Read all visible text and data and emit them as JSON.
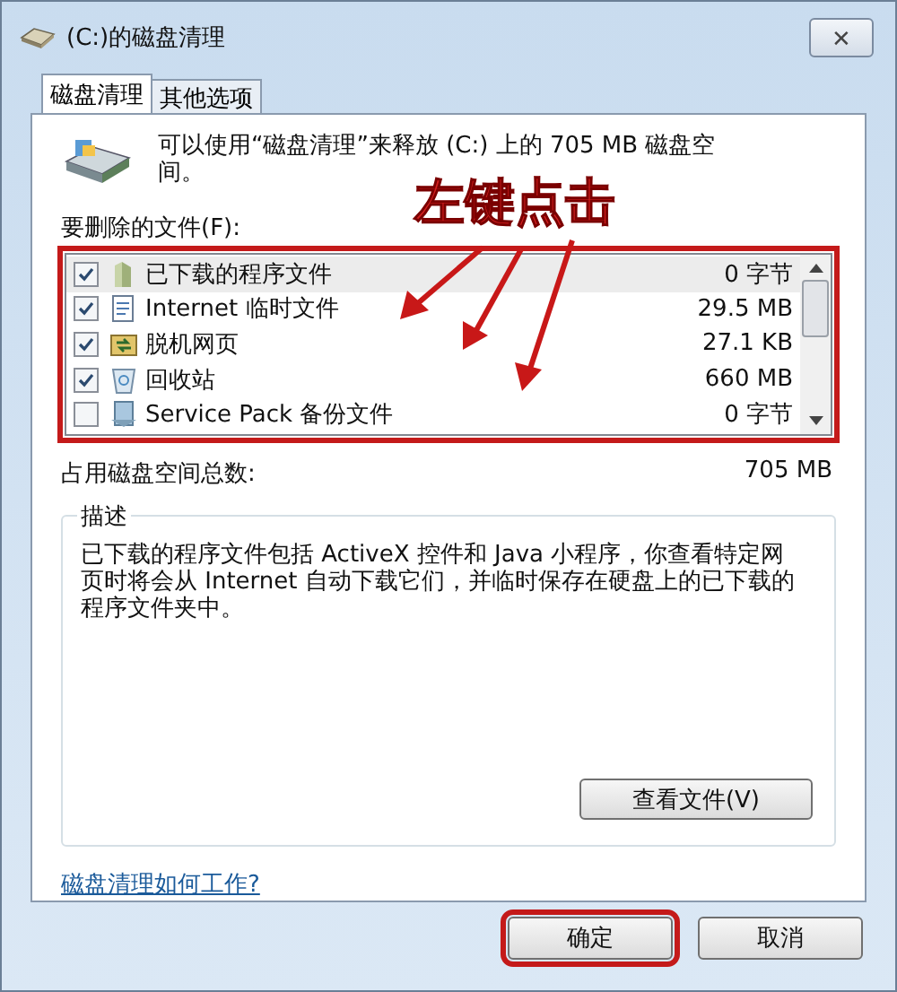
{
  "window": {
    "title": "(C:)的磁盘清理",
    "close": "✕"
  },
  "tabs": [
    {
      "label": "磁盘清理",
      "selected": true
    },
    {
      "label": "其他选项",
      "selected": false
    }
  ],
  "header_text": "可以使用“磁盘清理”来释放 (C:) 上的 705 MB 磁盘空间。",
  "files_label": "要删除的文件(F):",
  "files": [
    {
      "name": "已下载的程序文件",
      "size": "0 字节",
      "checked": true,
      "selected": true
    },
    {
      "name": "Internet 临时文件",
      "size": "29.5 MB",
      "checked": true,
      "selected": false
    },
    {
      "name": "脱机网页",
      "size": "27.1 KB",
      "checked": true,
      "selected": false
    },
    {
      "name": "回收站",
      "size": "660 MB",
      "checked": true,
      "selected": false
    },
    {
      "name": "Service Pack 备份文件",
      "size": "0 字节",
      "checked": false,
      "selected": false
    }
  ],
  "total": {
    "label": "占用磁盘空间总数:",
    "value": "705 MB"
  },
  "description": {
    "title": "描述",
    "text": "已下载的程序文件包括 ActiveX 控件和 Java 小程序，你查看特定网页时将会从 Internet 自动下载它们，并临时保存在硬盘上的已下载的程序文件夹中。",
    "button": "查看文件(V)"
  },
  "help_link": "磁盘清理如何工作?",
  "buttons": [
    {
      "label": "确定",
      "highlighted": true
    },
    {
      "label": "取消",
      "highlighted": false
    }
  ],
  "annotation": {
    "text": "左键点击"
  }
}
